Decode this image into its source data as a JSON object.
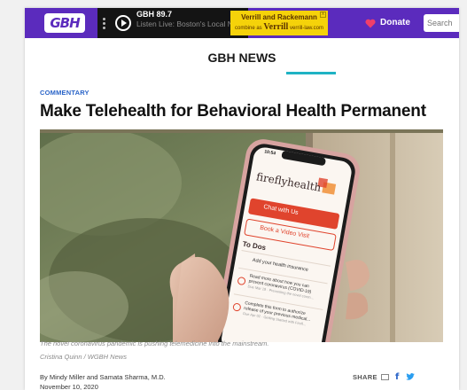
{
  "header": {
    "logo_text": "GBH",
    "radio_station": "GBH 89.7",
    "radio_now_playing": "Listen Live: Boston's Local NPR",
    "ad_line1": "Verrill and Rackemann",
    "ad_line2_prefix": "combine as",
    "ad_brand": "Verrill",
    "ad_url": "verrill-law.com",
    "ad_close": "x",
    "donate_label": "Donate",
    "search_placeholder": "Search"
  },
  "section": {
    "title": "GBH NEWS"
  },
  "article": {
    "kicker": "COMMENTARY",
    "headline": "Make Telehealth for Behavioral Health Permanent",
    "image_caption": "The novel coronavirus pandemic is pushing telemedicine into the mainstream.",
    "image_credit": "Cristina Quinn / WGBH News",
    "byline": "By Mindy Miller and Samata Sharma, M.D.",
    "date": "November 10, 2020",
    "share_label": "SHARE"
  },
  "phone_screen": {
    "time": "10:54",
    "app_name": "fireflyhealth",
    "chat_button": "Chat with Us",
    "video_button": "Book a Video Visit",
    "todos_title": "To Dos",
    "todo1": "Add your health insurance",
    "todo2_line1": "Read more about how you can",
    "todo2_line2": "prevent coronavirus (COVID-19)",
    "todo2_line3": "Due Mar 19 · Preventing the novel coron...",
    "todo3_line1": "Complete this form to authorize",
    "todo3_line2": "release of your previous medical...",
    "todo3_line3": "Due Apr 02 · Getting Started with Firefl..."
  },
  "colors": {
    "brand_purple": "#5b2bbd",
    "accent_teal": "#1fb3c4",
    "link_blue": "#2a64c8",
    "app_red": "#e0442d",
    "ad_yellow": "#f5d20a"
  }
}
